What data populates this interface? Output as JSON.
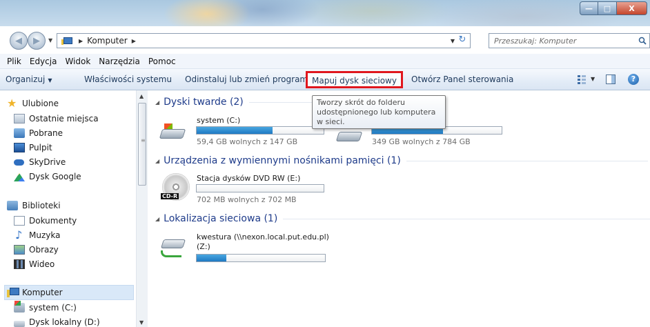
{
  "window": {
    "min_label": "—",
    "max_label": "□",
    "close_label": "X"
  },
  "address": {
    "crumb": "Komputer",
    "search_placeholder": "Przeszukaj: Komputer"
  },
  "menu": [
    "Plik",
    "Edycja",
    "Widok",
    "Narzędzia",
    "Pomoc"
  ],
  "commands": {
    "organize": "Organizuj",
    "properties": "Właściwości systemu",
    "uninstall": "Odinstaluj lub zmień program",
    "map_drive": "Mapuj dysk sieciowy",
    "control_panel": "Otwórz Panel sterowania"
  },
  "tooltip": {
    "text": "Tworzy skrót do folderu udostępnionego lub komputera w sieci."
  },
  "sidebar": {
    "favorites": "Ulubione",
    "items_fav": [
      "Ostatnie miejsca",
      "Pobrane",
      "Pulpit",
      "SkyDrive",
      "Dysk Google"
    ],
    "libraries": "Biblioteki",
    "items_lib": [
      "Dokumenty",
      "Muzyka",
      "Obrazy",
      "Wideo"
    ],
    "computer": "Komputer",
    "items_pc": [
      "system (C:)",
      "Dysk lokalny (D:)"
    ]
  },
  "groups": {
    "hdd": "Dyski twarde (2)",
    "removable": "Urządzenia z wymiennymi nośnikami pamięci (1)",
    "network": "Lokalizacja sieciowa (1)"
  },
  "drives": {
    "c": {
      "name": "system (C:)",
      "free": "59,4 GB wolnych z 147 GB",
      "used_fraction": 0.6
    },
    "d": {
      "name": "",
      "free": "349 GB wolnych z 784 GB",
      "used_fraction": 0.55
    },
    "dvd": {
      "name": "Stacja dysków DVD RW (E:)",
      "free": "702 MB wolnych z 702 MB",
      "used_fraction": 0.0,
      "label": "CD-R"
    },
    "net": {
      "name_line1": "kwestura (\\\\nexon.local.put.edu.pl)",
      "name_line2": "(Z:)",
      "used_fraction": 0.23
    }
  }
}
